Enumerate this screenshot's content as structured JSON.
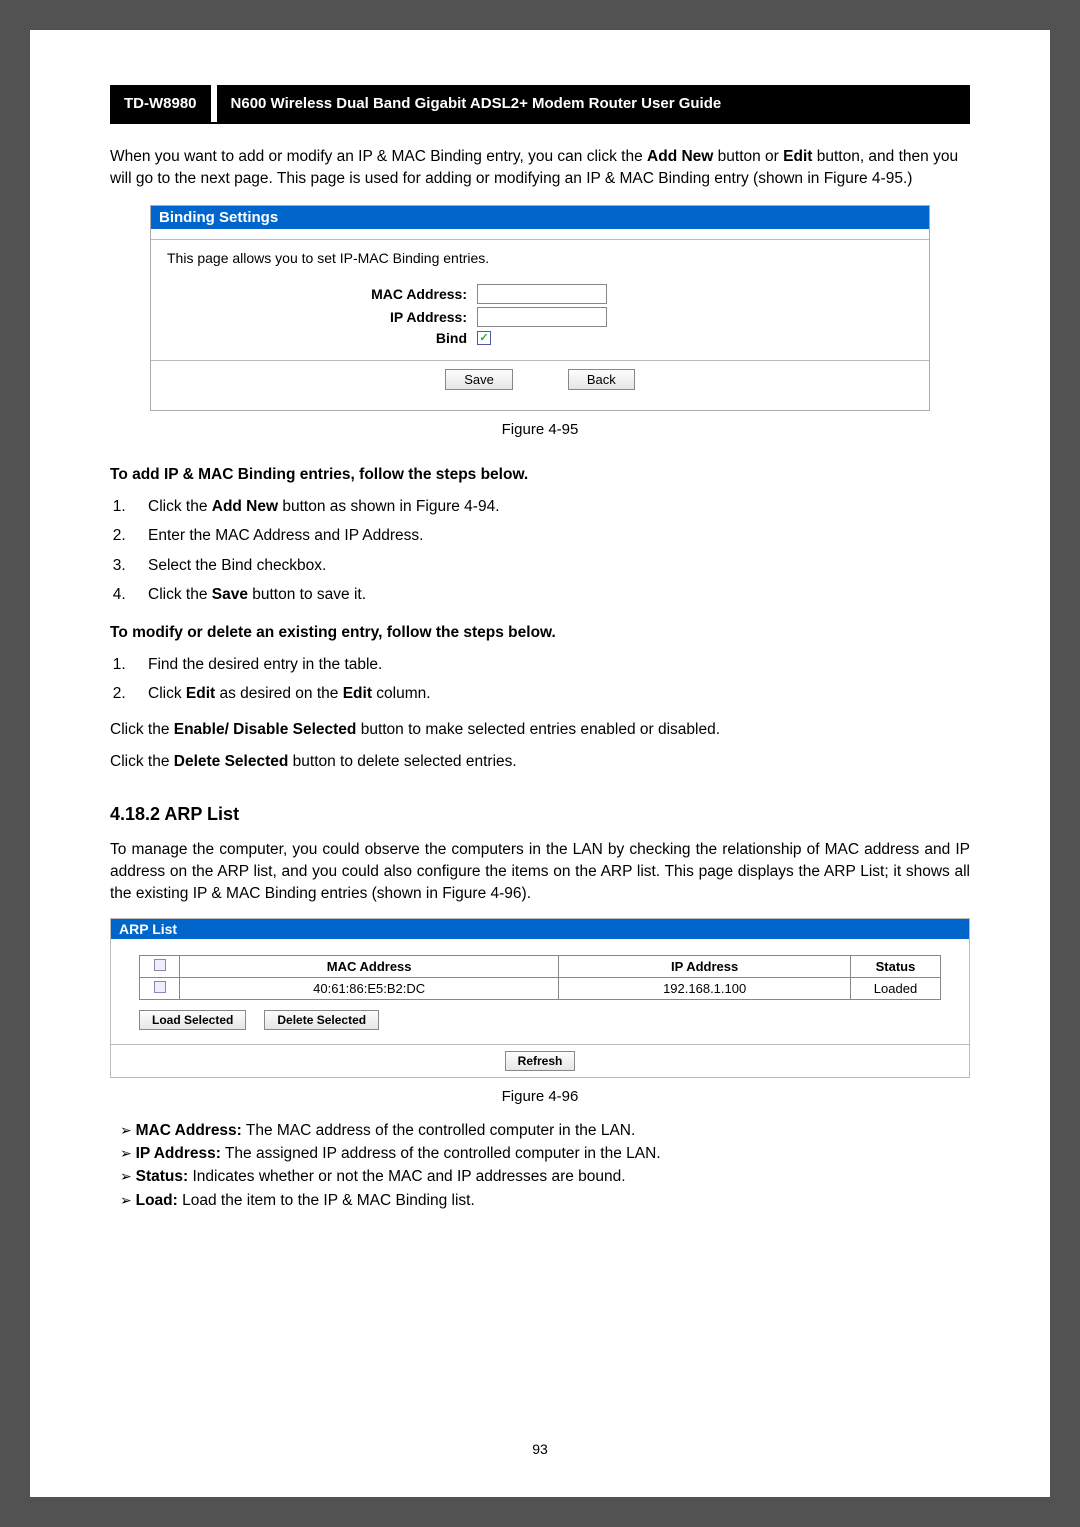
{
  "header": {
    "model": "TD-W8980",
    "title": "N600 Wireless Dual Band Gigabit ADSL2+ Modem Router User Guide"
  },
  "intro": {
    "p1_a": "When you want to add or modify an IP & MAC Binding entry, you can click the ",
    "p1_b": "Add New",
    "p1_c": " button or ",
    "p1_d": "Edit",
    "p1_e": " button, and then you will go to the next page. This page is used for adding or modifying an IP & MAC Binding entry (shown in Figure 4-95.)"
  },
  "binding_panel": {
    "title": "Binding Settings",
    "desc": "This page allows you to set IP-MAC Binding entries.",
    "mac_label": "MAC Address:",
    "ip_label": "IP Address:",
    "bind_label": "Bind",
    "save": "Save",
    "back": "Back"
  },
  "figure95": "Figure 4-95",
  "add_heading": "To add IP & MAC Binding entries, follow the steps below.",
  "add_steps": {
    "s1a": "Click the ",
    "s1b": "Add New",
    "s1c": " button as shown in Figure 4-94.",
    "s2": "Enter the MAC Address and IP Address.",
    "s3": "Select the Bind checkbox.",
    "s4a": "Click the ",
    "s4b": "Save",
    "s4c": " button to save it."
  },
  "modify_heading": "To modify or delete an existing entry, follow the steps below.",
  "modify_steps": {
    "s1": "Find the desired entry in the table.",
    "s2a": "Click ",
    "s2b": "Edit",
    "s2c": " as desired on the ",
    "s2d": "Edit",
    "s2e": " column."
  },
  "enable_line": {
    "a": "Click the ",
    "b": "Enable/ Disable Selected",
    "c": " button to make selected entries enabled or disabled."
  },
  "delete_line": {
    "a": "Click the ",
    "b": "Delete Selected",
    "c": " button to delete selected entries."
  },
  "arp": {
    "heading": "4.18.2 ARP List",
    "desc": "To manage the computer, you could observe the computers in the LAN by checking the relationship of MAC address and IP address on the ARP list, and you could also configure the items on the ARP list. This page displays the ARP List; it shows all the existing IP & MAC Binding entries (shown in Figure 4-96).",
    "panel_title": "ARP List",
    "col_mac": "MAC Address",
    "col_ip": "IP Address",
    "col_status": "Status",
    "row_mac": "40:61:86:E5:B2:DC",
    "row_ip": "192.168.1.100",
    "row_status": "Loaded",
    "load_btn": "Load Selected",
    "delete_btn": "Delete Selected",
    "refresh_btn": "Refresh"
  },
  "figure96": "Figure 4-96",
  "bullets": {
    "mac_a": "MAC Address:",
    "mac_b": " The MAC address of the controlled computer in the LAN.",
    "ip_a": "IP Address:",
    "ip_b": " The assigned IP address of the controlled computer in the LAN.",
    "status_a": "Status:",
    "status_b": " Indicates whether or not the MAC and IP addresses are bound.",
    "load_a": "Load:",
    "load_b": " Load the item to the IP & MAC Binding list."
  },
  "page_number": "93"
}
